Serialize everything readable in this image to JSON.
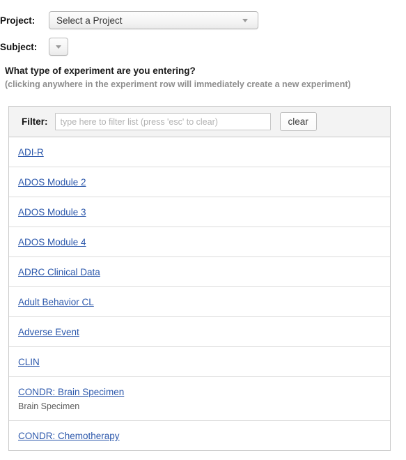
{
  "form": {
    "project": {
      "label": "Project:",
      "value": "Select a Project"
    },
    "subject": {
      "label": "Subject:",
      "value": ""
    }
  },
  "headings": {
    "main": "What type of experiment are you entering?",
    "sub": "(clicking anywhere in the experiment row will immediately create a new experiment)"
  },
  "filter": {
    "label": "Filter:",
    "value": "",
    "placeholder": "type here to filter list (press 'esc' to clear)",
    "clear_label": "clear"
  },
  "experiments": [
    {
      "name": "ADI-R",
      "description": ""
    },
    {
      "name": "ADOS Module 2",
      "description": ""
    },
    {
      "name": "ADOS Module 3",
      "description": ""
    },
    {
      "name": "ADOS Module 4",
      "description": ""
    },
    {
      "name": "ADRC Clinical Data",
      "description": ""
    },
    {
      "name": "Adult Behavior CL",
      "description": ""
    },
    {
      "name": "Adverse Event",
      "description": ""
    },
    {
      "name": "CLIN",
      "description": ""
    },
    {
      "name": "CONDR: Brain Specimen",
      "description": "Brain Specimen"
    },
    {
      "name": "CONDR: Chemotherapy",
      "description": ""
    }
  ],
  "colors": {
    "link": "#2b57ab",
    "heading_sub": "#8d8d8d",
    "panel_border": "#c9c9c9",
    "filter_bar_bg": "#f3f3f3"
  }
}
